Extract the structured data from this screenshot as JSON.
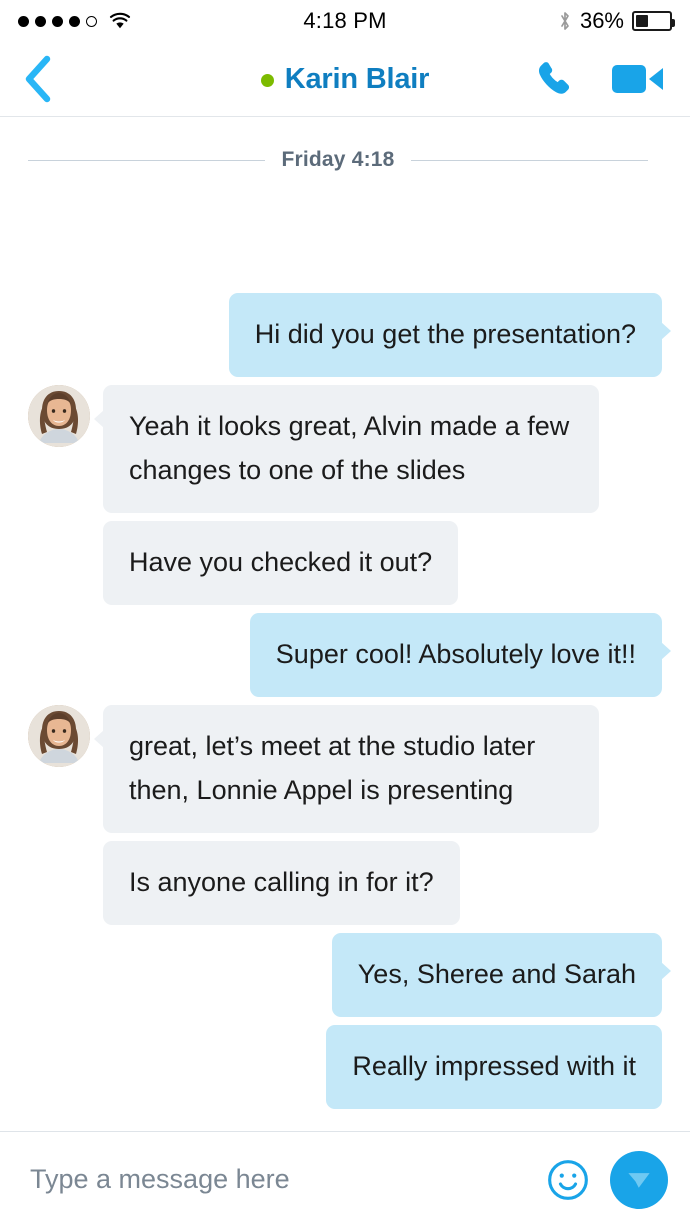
{
  "status_bar": {
    "signal_dots_filled": 4,
    "signal_dots_total": 5,
    "wifi_icon": "wifi-icon",
    "time": "4:18 PM",
    "bluetooth_icon": "bluetooth-icon",
    "battery_percent_label": "36%",
    "battery_level": 36
  },
  "nav": {
    "back_icon": "chevron-left-icon",
    "presence": "online",
    "presence_color": "#7cbb00",
    "title": "Karin Blair",
    "title_color": "#0f7ec0",
    "call_icon": "phone-icon",
    "video_icon": "video-camera-icon"
  },
  "conversation": {
    "date_divider": "Friday 4:18",
    "messages": [
      {
        "direction": "out",
        "text": "Hi did you get the presentation?",
        "tail": true,
        "avatar": false
      },
      {
        "direction": "in",
        "text": "Yeah it looks great, Alvin made a few changes to one of the slides",
        "tail": true,
        "avatar": true
      },
      {
        "direction": "in",
        "text": "Have you checked it out?",
        "tail": false,
        "avatar": false
      },
      {
        "direction": "out",
        "text": "Super cool! Absolutely love it!!",
        "tail": true,
        "avatar": false
      },
      {
        "direction": "in",
        "text": "great, let’s meet at the studio later then, Lonnie Appel is presenting",
        "tail": true,
        "avatar": true
      },
      {
        "direction": "in",
        "text": "Is anyone calling in for it?",
        "tail": false,
        "avatar": false
      },
      {
        "direction": "out",
        "text": "Yes, Sheree and Sarah",
        "tail": true,
        "avatar": false
      },
      {
        "direction": "out",
        "text": "Really impressed with it",
        "tail": false,
        "avatar": false
      }
    ]
  },
  "composer": {
    "placeholder": "Type a message here",
    "value": "",
    "emoji_icon": "smiley-face-icon",
    "send_icon": "send-paper-plane-icon",
    "send_button_color": "#19a4e8"
  },
  "colors": {
    "outgoing_bubble": "#c4e8f8",
    "incoming_bubble": "#eef1f4",
    "accent": "#19a4e8",
    "text": "#1b1b1b"
  }
}
